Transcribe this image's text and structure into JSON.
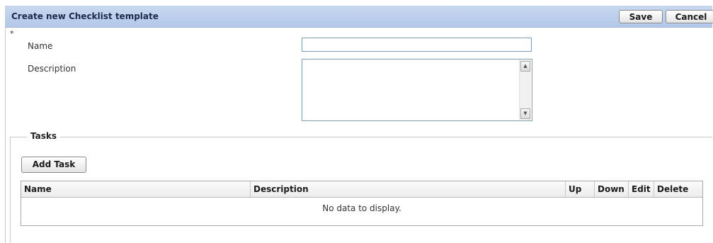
{
  "header": {
    "title": "Create new Checklist template",
    "save_label": "Save",
    "cancel_label": "Cancel",
    "background": "#b8cbeb"
  },
  "form": {
    "required_mark": "*",
    "name_label": "Name",
    "name_value": "",
    "description_label": "Description",
    "description_value": ""
  },
  "tasks": {
    "legend": "Tasks",
    "add_task_label": "Add Task",
    "columns": [
      "Name",
      "Description",
      "Up",
      "Down",
      "Edit",
      "Delete"
    ],
    "rows": [],
    "empty_message": "No data to display."
  }
}
